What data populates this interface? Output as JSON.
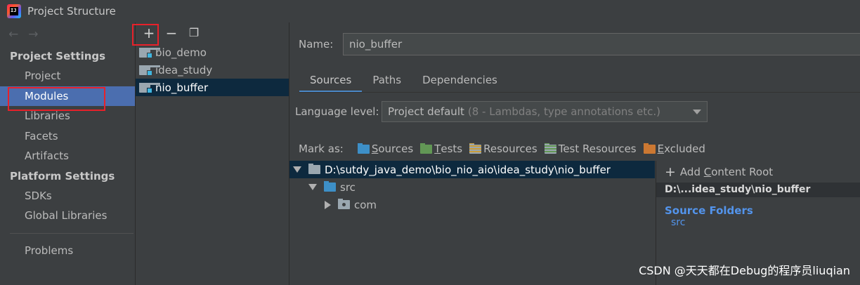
{
  "window": {
    "title": "Project Structure",
    "icon_text": "IJ"
  },
  "nav": {
    "back_arrow": "←",
    "forward_arrow": "→",
    "project_settings_header": "Project Settings",
    "project_items": [
      "Project",
      "Modules",
      "Libraries",
      "Facets",
      "Artifacts"
    ],
    "platform_settings_header": "Platform Settings",
    "platform_items": [
      "SDKs",
      "Global Libraries"
    ],
    "problems": "Problems",
    "selected": "Modules"
  },
  "module_list": {
    "toolbar": {
      "add": "+",
      "remove": "−",
      "copy": "❐"
    },
    "items": [
      "bio_demo",
      "idea_study",
      "nio_buffer"
    ],
    "selected": "nio_buffer"
  },
  "detail": {
    "name_label": "Name:",
    "name_value": "nio_buffer",
    "tabs": [
      "Sources",
      "Paths",
      "Dependencies"
    ],
    "active_tab": "Sources",
    "language_level_label": "Language level:",
    "language_level_value": "Project default",
    "language_level_hint": "(8 - Lambdas, type annotations etc.)",
    "mark_as_label": "Mark as:",
    "mark_as": [
      {
        "u": "S",
        "rest": "ources",
        "color": "#3d8fc7"
      },
      {
        "u": "T",
        "rest": "ests",
        "color": "#629755"
      },
      {
        "u": "",
        "rest": "Resources",
        "color": "#9aa7b0"
      },
      {
        "u": "",
        "rest": "Test Resources",
        "color": "#9aa7b0"
      },
      {
        "u": "E",
        "rest": "xcluded",
        "color": "#cc7832"
      }
    ],
    "tree": {
      "root": "D:\\sutdy_java_demo\\bio_nio_aio\\idea_study\\nio_buffer",
      "src": "src",
      "com": "com"
    },
    "content_root": {
      "add_plus": "+",
      "add_label_pre": "Add ",
      "add_label_u": "C",
      "add_label_post": "ontent Root",
      "path": "D:\\...idea_study\\nio_buffer",
      "source_folders_title": "Source Folders",
      "source_folders": [
        "src"
      ]
    }
  },
  "watermark": "CSDN @天天都在Debug的程序员liuqian"
}
